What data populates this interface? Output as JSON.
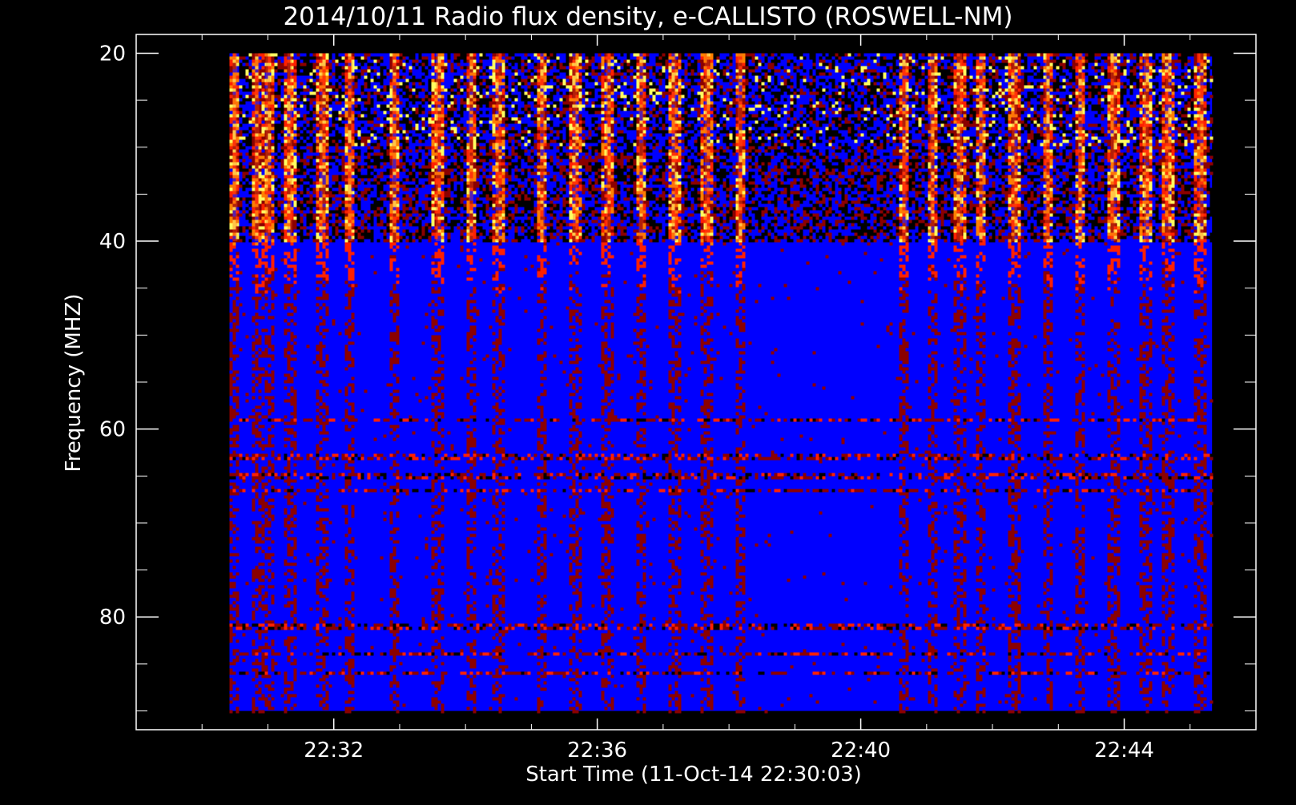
{
  "chart_data": {
    "type": "heatmap",
    "title": "2014/10/11  Radio flux density, e-CALLISTO (ROSWELL-NM)",
    "xlabel": "Start Time (11-Oct-14 22:30:03)",
    "ylabel": "Frequency (MHZ)",
    "x_range": [
      "22:29:00",
      "22:46:00"
    ],
    "data_x_range": [
      "22:30:25",
      "22:45:20"
    ],
    "y_range": [
      18.0,
      92.0
    ],
    "y_reversed": true,
    "data_y_range": [
      20.0,
      90.0
    ],
    "x_ticks": [
      "22:32",
      "22:36",
      "22:40",
      "22:44"
    ],
    "x_minor_step_minutes": 1,
    "y_ticks": [
      20,
      40,
      60,
      80
    ],
    "y_minor_step": 5,
    "colormap": [
      "#000000",
      "#0000ff",
      "#8b0000",
      "#ff2000",
      "#ff8000",
      "#ffff60"
    ],
    "background_level": "blue",
    "strong_emission_band_mhz": [
      20,
      40
    ],
    "strong_emission_times": [
      "22:30:30",
      "22:30:50",
      "22:31:00",
      "22:31:20",
      "22:31:50",
      "22:32:15",
      "22:32:55",
      "22:33:35",
      "22:34:05",
      "22:34:30",
      "22:35:10",
      "22:35:40",
      "22:36:10",
      "22:36:40",
      "22:37:10",
      "22:37:40",
      "22:38:10",
      "22:40:40",
      "22:41:05",
      "22:41:30",
      "22:41:50",
      "22:42:20",
      "22:42:50",
      "22:43:20",
      "22:43:50",
      "22:44:20",
      "22:44:40",
      "22:45:10"
    ],
    "horizontal_interference_freqs_mhz": [
      27,
      28,
      29.5,
      59,
      63,
      65,
      66.5,
      81,
      84,
      86
    ]
  }
}
